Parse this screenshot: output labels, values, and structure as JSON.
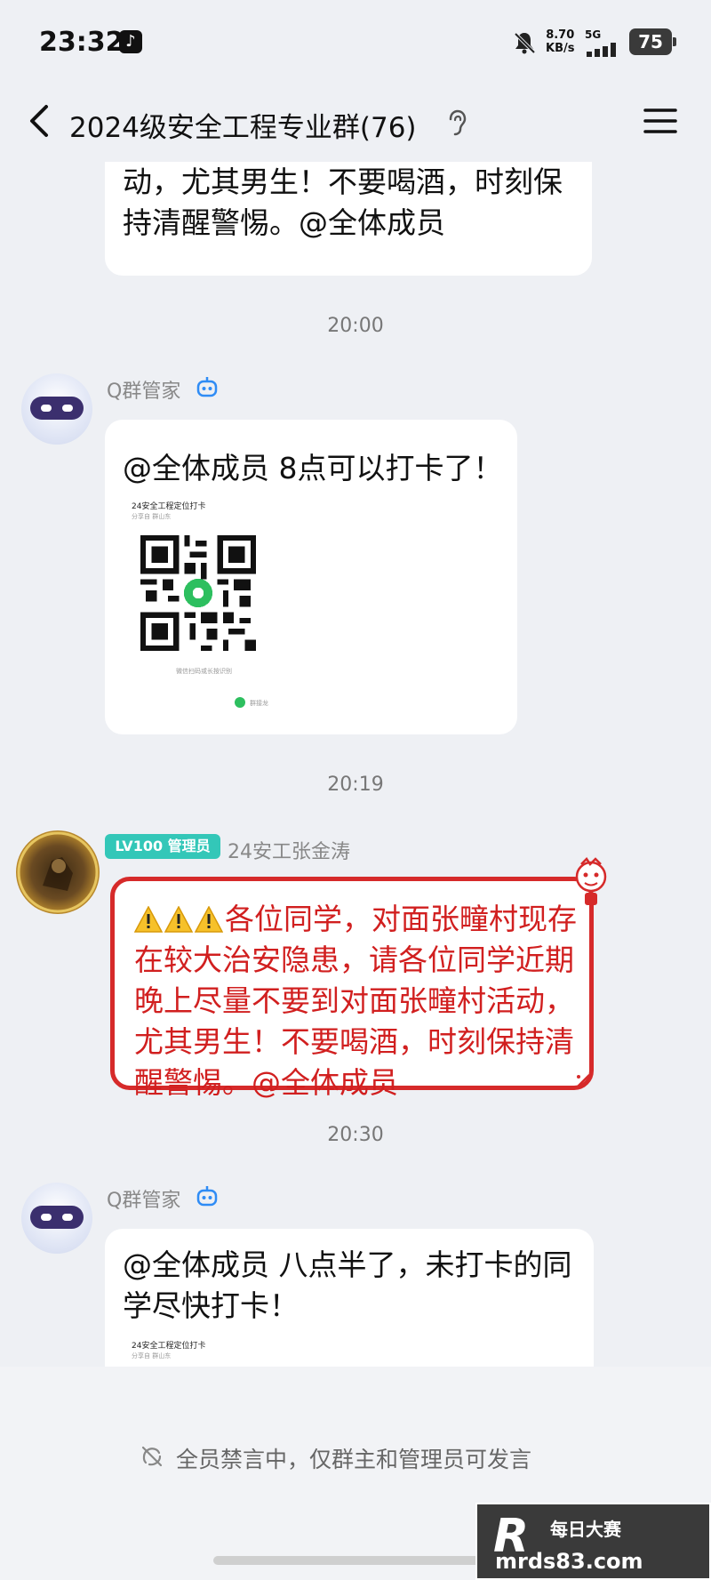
{
  "status_bar": {
    "time": "23:32",
    "net_speed_value": "8.70",
    "net_speed_unit": "KB/s",
    "network": "5G",
    "battery": "75"
  },
  "header": {
    "title": "2024级安全工程专业群(76)"
  },
  "messages": {
    "first_partial_text": "近期晚上尽量不要到对面张疃村活动，尤其男生！不要喝酒，时刻保持清醒警惕。@全体成员",
    "timestamp_1": "20:00",
    "bot_name_1": "Q群管家",
    "bot_message_1": "@全体成员 8点可以打卡了！",
    "card_1_title": "24安全工程定位打卡",
    "card_1_subtitle": "分享自 群山东",
    "card_1_hint": "微信扫码或长按识别",
    "card_1_footer": "群接龙",
    "timestamp_2": "20:19",
    "admin_badge": "LV100 管理员",
    "admin_name": "24安工张金涛",
    "admin_message": "⚠️⚠️⚠️各位同学，对面张疃村现存在较大治安隐患，请各位同学近期晚上尽量不要到对面张疃村活动，尤其男生！不要喝酒，时刻保持清醒警惕。@全体成员",
    "admin_message_body": "各位同学，对面张疃村现存在较大治安隐患，请各位同学近期晚上尽量不要到对面张疃村活动，尤其男生！不要喝酒，时刻保持清醒警惕。@全体成员",
    "timestamp_3": "20:30",
    "bot_name_2": "Q群管家",
    "bot_message_2": "@全体成员 八点半了，未打卡的同学尽快打卡！",
    "card_2_title": "24安全工程定位打卡",
    "card_2_subtitle": "分享自 群山东"
  },
  "footer": {
    "mute_notice": "全员禁言中，仅群主和管理员可发言"
  },
  "watermark": {
    "logo": "R",
    "name": "每日大赛",
    "url": "mrds83.com"
  },
  "icons": {
    "back": "chevron-left-icon",
    "menu": "hamburger-menu-icon",
    "bell": "bell-off-icon",
    "ear": "ear-icon",
    "bot": "robot-badge-icon",
    "warning": "warning-icon",
    "mute": "mute-icon"
  },
  "colors": {
    "background": "#eef0f4",
    "admin_badge": "#33c7b8",
    "alert_red": "#d62a2a",
    "bot_badge_blue": "#2f8cf5"
  }
}
